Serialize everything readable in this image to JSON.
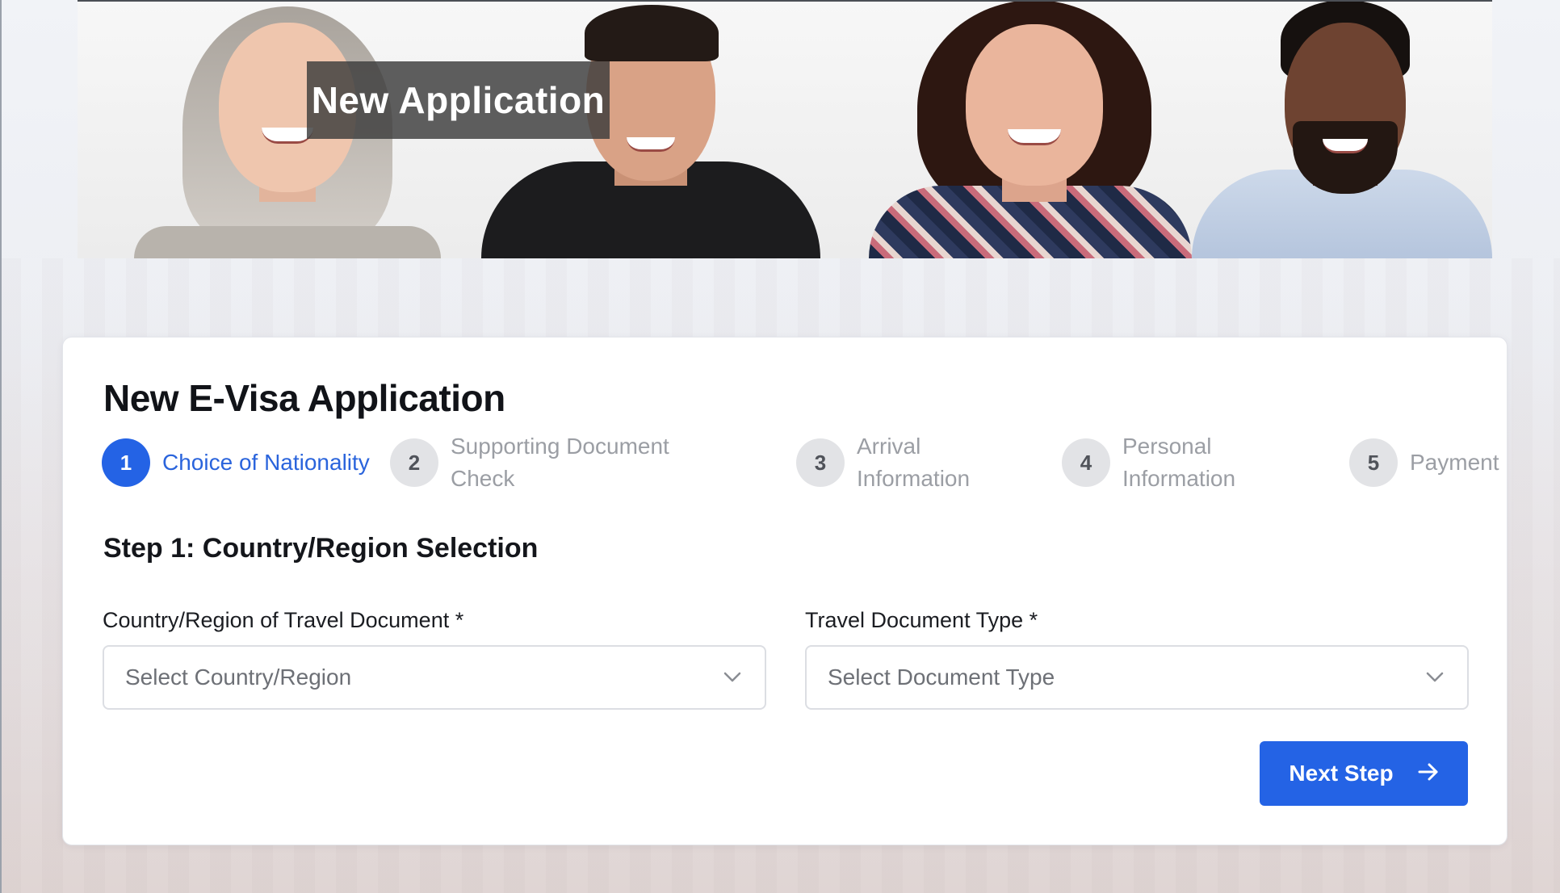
{
  "banner": {
    "title": "New Application"
  },
  "form": {
    "title": "New E-Visa Application",
    "steps": [
      {
        "number": "1",
        "label": "Choice of Nationality",
        "active": true
      },
      {
        "number": "2",
        "label": "Supporting Document Check",
        "active": false
      },
      {
        "number": "3",
        "label": "Arrival Information",
        "active": false
      },
      {
        "number": "4",
        "label": "Personal Information",
        "active": false
      },
      {
        "number": "5",
        "label": "Payment",
        "active": false
      }
    ],
    "section_title": "Step 1: Country/Region Selection",
    "fields": {
      "country": {
        "label": "Country/Region of Travel Document *",
        "placeholder": "Select Country/Region",
        "value": ""
      },
      "document_type": {
        "label": "Travel Document Type *",
        "placeholder": "Select Document Type",
        "value": ""
      }
    },
    "next_button": {
      "label": "Next Step",
      "icon": "arrow-right-icon"
    }
  },
  "colors": {
    "accent": "#2463e5",
    "active_step_text": "#2a64dc",
    "inactive_step_circle": "#e2e3e6",
    "inactive_step_text": "#9b9ea4"
  }
}
